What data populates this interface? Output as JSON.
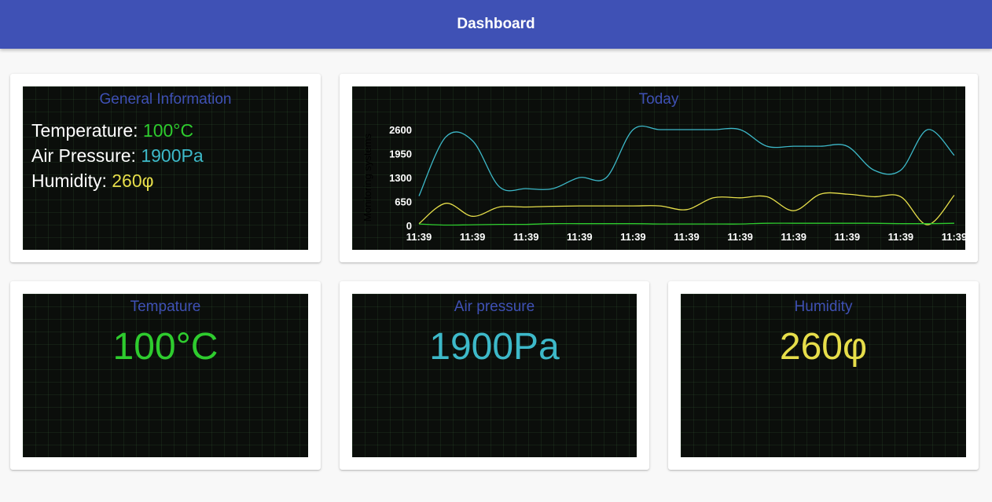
{
  "header": {
    "title": "Dashboard"
  },
  "general_info": {
    "title": "General Information",
    "rows": [
      {
        "label": "Temperature: ",
        "value": "100°C"
      },
      {
        "label": "Air Pressure: ",
        "value": "1900Pa"
      },
      {
        "label": "Humidity: ",
        "value": "260φ"
      }
    ]
  },
  "today": {
    "title": "Today",
    "ylabel": "Monitoring systems"
  },
  "cards": {
    "temperature": {
      "title": "Tempature",
      "value": "100°C"
    },
    "pressure": {
      "title": "Air pressure",
      "value": "1900Pa"
    },
    "humidity": {
      "title": "Humidity",
      "value": "260φ"
    }
  },
  "colors": {
    "accent": "#3f51b5",
    "temperature": "#2ecc2e",
    "pressure": "#3db9c9",
    "humidity": "#e6de4a",
    "panel_bg": "#0b0e0b"
  },
  "chart_data": {
    "type": "line",
    "title": "Today",
    "ylabel": "Monitoring systems",
    "xlabel": "",
    "x": [
      "11:39",
      "11:39",
      "11:39",
      "11:39",
      "11:39",
      "11:39",
      "11:39",
      "11:39",
      "11:39",
      "11:39",
      "11:39"
    ],
    "yticks": [
      0,
      650,
      1300,
      1950,
      2600
    ],
    "ylim": [
      0,
      2600
    ],
    "grid": false,
    "series": [
      {
        "color": "#3db9c9",
        "values": [
          800,
          2400,
          2300,
          1050,
          1000,
          1000,
          1300,
          1300,
          2600,
          2600,
          2600,
          2600,
          2600,
          2150,
          2150,
          2150,
          2150,
          1500,
          1500,
          2600,
          1900
        ]
      },
      {
        "color": "#e6de4a",
        "values": [
          50,
          600,
          250,
          500,
          500,
          520,
          530,
          530,
          530,
          530,
          430,
          750,
          750,
          780,
          400,
          850,
          850,
          780,
          780,
          20,
          820
        ]
      },
      {
        "color": "#2ecc2e",
        "values": [
          40,
          10,
          20,
          30,
          30,
          50,
          50,
          50,
          50,
          40,
          40,
          40,
          40,
          60,
          60,
          60,
          60,
          60,
          50,
          50,
          60
        ]
      }
    ]
  }
}
